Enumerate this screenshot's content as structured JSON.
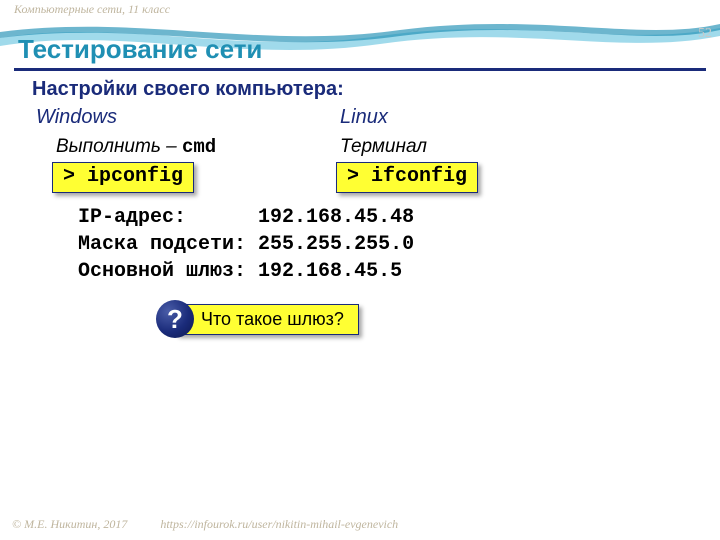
{
  "header": "Компьютерные сети, 11 класс",
  "page_number": "52",
  "title": "Тестирование сети",
  "subtitle": "Настройки своего компьютера:",
  "os": {
    "windows": "Windows",
    "linux": "Linux"
  },
  "run": {
    "label": "Выполнить",
    "dash": " – ",
    "cmd": "cmd"
  },
  "terminal": "Терминал",
  "commands": {
    "ipconfig": "> ipconfig",
    "ifconfig": "> ifconfig"
  },
  "net": {
    "ip_label": "IP-адрес:",
    "ip_value": "192.168.45.48",
    "mask_label": "Маска подсети:",
    "mask_value": "255.255.255.0",
    "gw_label": "Основной шлюз:",
    "gw_value": "192.168.45.5"
  },
  "question": {
    "mark": "?",
    "text": "Что такое шлюз?"
  },
  "footer": {
    "copyright": "© М.Е. Никитин, 2017",
    "url": "https://infourok.ru/user/nikitin-mihail-evgenevich"
  }
}
